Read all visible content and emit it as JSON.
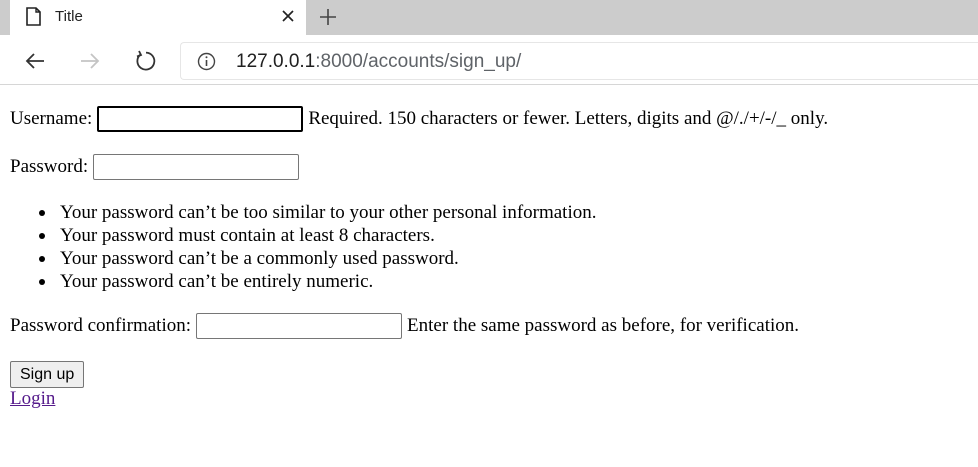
{
  "browser": {
    "tab": {
      "title": "Title"
    },
    "address_bar": {
      "host": "127.0.0.1",
      "rest": ":8000/accounts/sign_up/"
    }
  },
  "form": {
    "username": {
      "label": "Username:",
      "value": "",
      "help": "Required. 150 characters or fewer. Letters, digits and @/./+/-/_ only."
    },
    "password": {
      "label": "Password:",
      "value": "",
      "rules": [
        "Your password can’t be too similar to your other personal information.",
        "Your password must contain at least 8 characters.",
        "Your password can’t be a commonly used password.",
        "Your password can’t be entirely numeric."
      ]
    },
    "password_confirmation": {
      "label": "Password confirmation:",
      "value": "",
      "help": "Enter the same password as before, for verification."
    },
    "submit_label": "Sign up",
    "login_link": "Login"
  },
  "colors": {
    "tabstrip": "#cccccc",
    "visited_link": "#551a8b",
    "button_bg": "#efefef"
  }
}
